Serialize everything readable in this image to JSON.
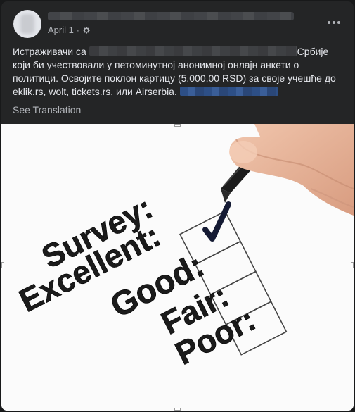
{
  "post": {
    "date": "April 1",
    "privacy_icon": "gear-icon",
    "more_icon": "more-options-icon",
    "text": {
      "segment1": "Истраживачи са",
      "segment2": "Србије који би учествовали у петоминутној анонимној онлајн анкети о политици. Освојите поклон картицу (5.000,00 RSD) за своје учешће до eklik.rs, wolt, tickets.rs, или Airserbia."
    },
    "see_translation": "See Translation"
  },
  "survey_image": {
    "labels": [
      "Survey:",
      "Excellent:",
      "Good:",
      "Fair:",
      "Poor:"
    ],
    "checked_index": 0
  },
  "colors": {
    "card_bg": "#242526",
    "text_primary": "#e4e6eb",
    "text_secondary": "#b0b3b8",
    "link_blue": "#2d88ff"
  }
}
